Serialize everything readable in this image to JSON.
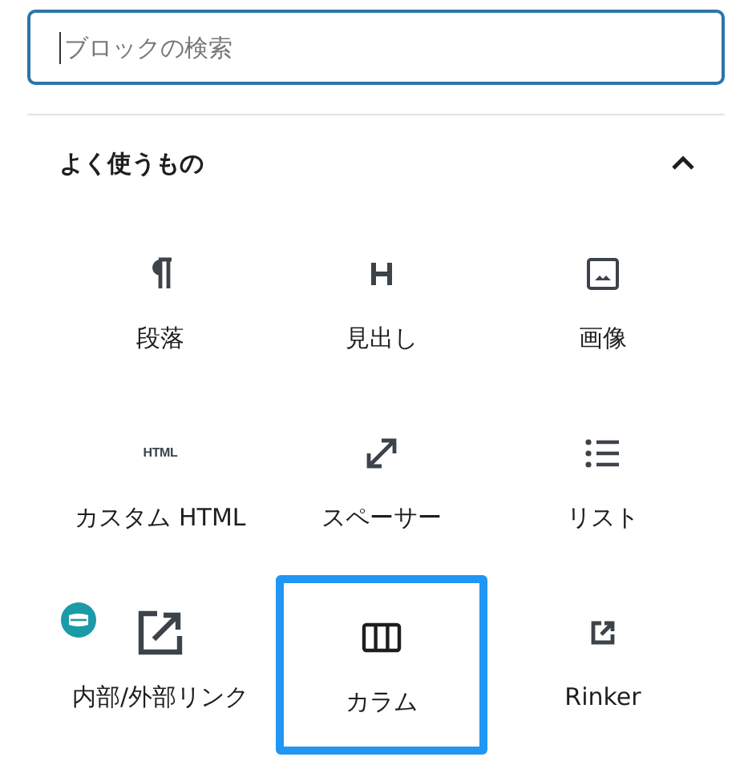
{
  "search": {
    "placeholder": "ブロックの検索"
  },
  "section": {
    "title": "よく使うもの",
    "expanded": true
  },
  "blocks": [
    {
      "label": "段落",
      "kind": "paragraph",
      "selected": false
    },
    {
      "label": "見出し",
      "kind": "heading",
      "selected": false
    },
    {
      "label": "画像",
      "kind": "image",
      "selected": false
    },
    {
      "label": "カスタム HTML",
      "kind": "html",
      "icon_text": "HTML",
      "selected": false
    },
    {
      "label": "スペーサー",
      "kind": "spacer",
      "selected": false
    },
    {
      "label": "リスト",
      "kind": "list",
      "selected": false
    },
    {
      "label": "内部/外部リンク",
      "kind": "link",
      "badge": true,
      "selected": false
    },
    {
      "label": "カラム",
      "kind": "columns",
      "selected": true
    },
    {
      "label": "Rinker",
      "kind": "external",
      "selected": false
    }
  ]
}
